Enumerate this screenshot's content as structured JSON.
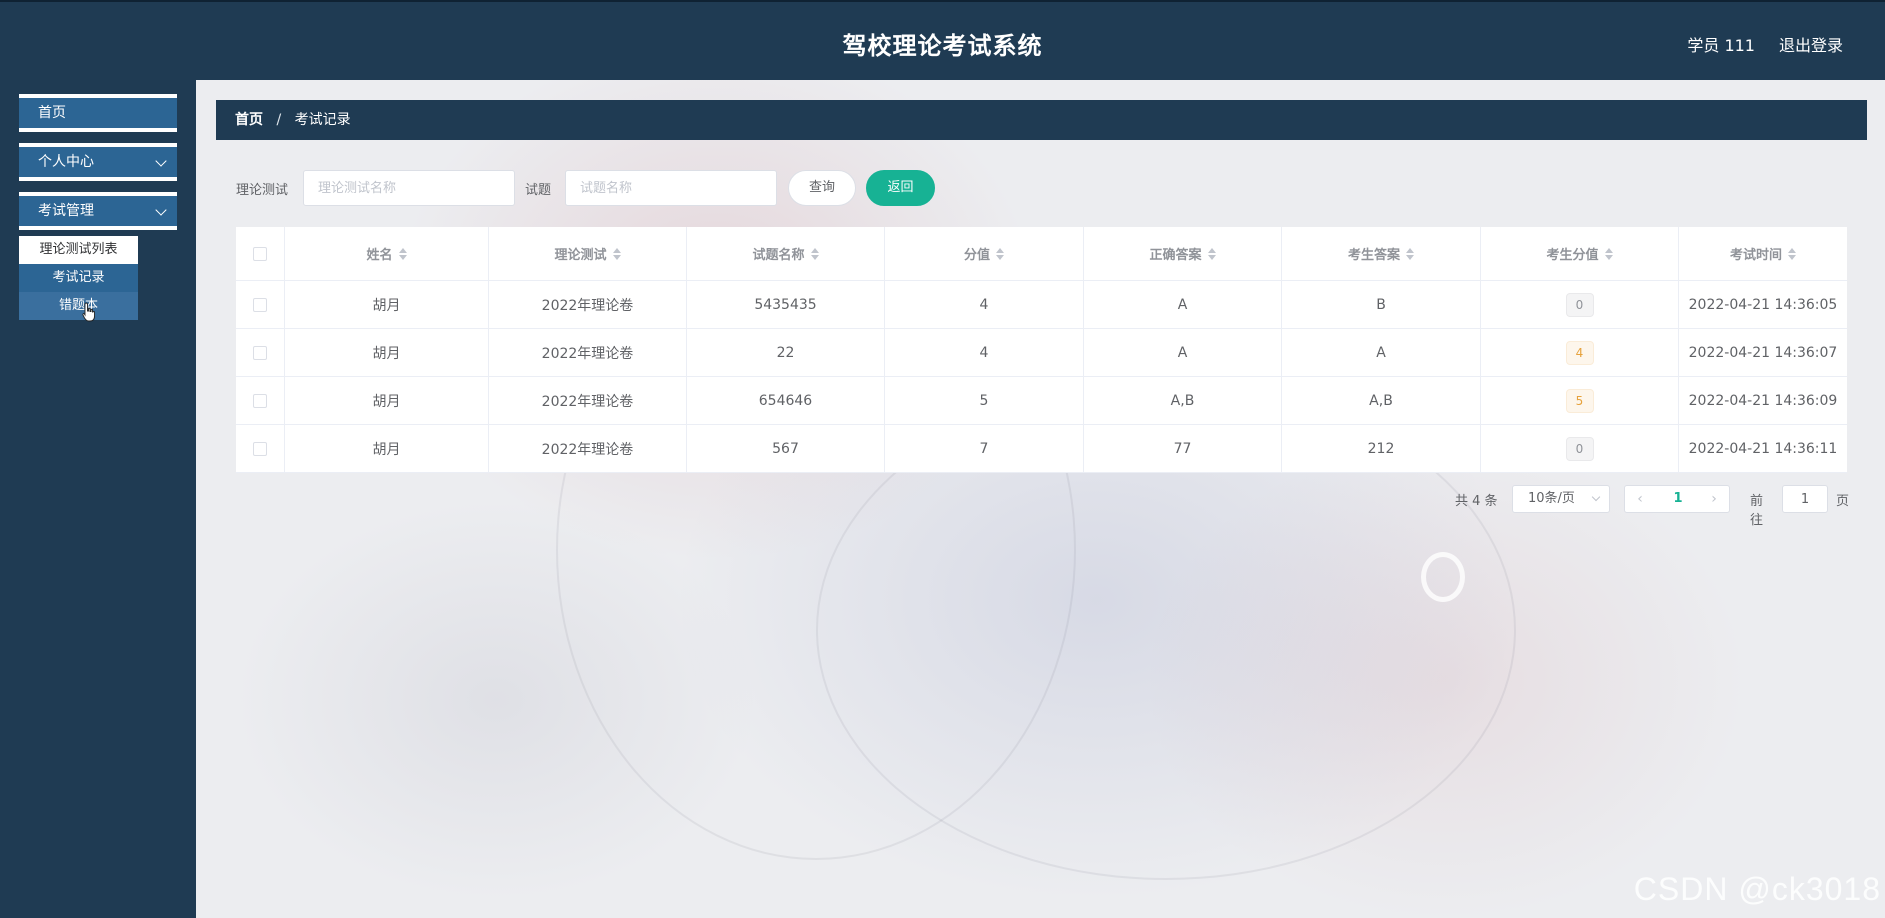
{
  "header": {
    "title": "驾校理论考试系统",
    "user": "学员 111",
    "logout": "退出登录"
  },
  "sidebar": {
    "items": [
      {
        "label": "首页"
      },
      {
        "label": "个人中心"
      },
      {
        "label": "考试管理"
      }
    ],
    "submenu": [
      {
        "label": "理论测试列表"
      },
      {
        "label": "考试记录"
      },
      {
        "label": "错题本"
      }
    ]
  },
  "breadcrumb": {
    "home": "首页",
    "separator": "/",
    "current": "考试记录"
  },
  "search": {
    "label1": "理论测试",
    "placeholder1": "理论测试名称",
    "label2": "试题",
    "placeholder2": "试题名称",
    "query_btn": "查询",
    "back_btn": "返回"
  },
  "table": {
    "columns": [
      "姓名",
      "理论测试",
      "试题名称",
      "分值",
      "正确答案",
      "考生答案",
      "考生分值",
      "考试时间"
    ],
    "rows": [
      {
        "name": "胡月",
        "test": "2022年理论卷",
        "question": "5435435",
        "score": "4",
        "correct": "A",
        "answer": "B",
        "got": "0",
        "time": "2022-04-21 14:36:05"
      },
      {
        "name": "胡月",
        "test": "2022年理论卷",
        "question": "22",
        "score": "4",
        "correct": "A",
        "answer": "A",
        "got": "4",
        "time": "2022-04-21 14:36:07"
      },
      {
        "name": "胡月",
        "test": "2022年理论卷",
        "question": "654646",
        "score": "5",
        "correct": "A,B",
        "answer": "A,B",
        "got": "5",
        "time": "2022-04-21 14:36:09"
      },
      {
        "name": "胡月",
        "test": "2022年理论卷",
        "question": "567",
        "score": "7",
        "correct": "77",
        "answer": "212",
        "got": "0",
        "time": "2022-04-21 14:36:11"
      }
    ]
  },
  "pagination": {
    "total": "共 4 条",
    "page_size": "10条/页",
    "current_page": "1",
    "goto_label": "前往",
    "goto_value": "1",
    "page_unit": "页"
  },
  "watermark": "CSDN @ck3018",
  "colors": {
    "header_bg": "#1f3b53",
    "menu_active": "#2c6594",
    "primary_green": "#17b294",
    "tag_warning": "#e6a23c",
    "tag_info": "#909399"
  },
  "icons": {
    "menu_expand": "chevron-down-icon",
    "sort": "sort-caret-icon",
    "pager_prev": "chevron-left-icon",
    "pager_next": "chevron-right-icon",
    "select_arrow": "chevron-down-icon"
  }
}
